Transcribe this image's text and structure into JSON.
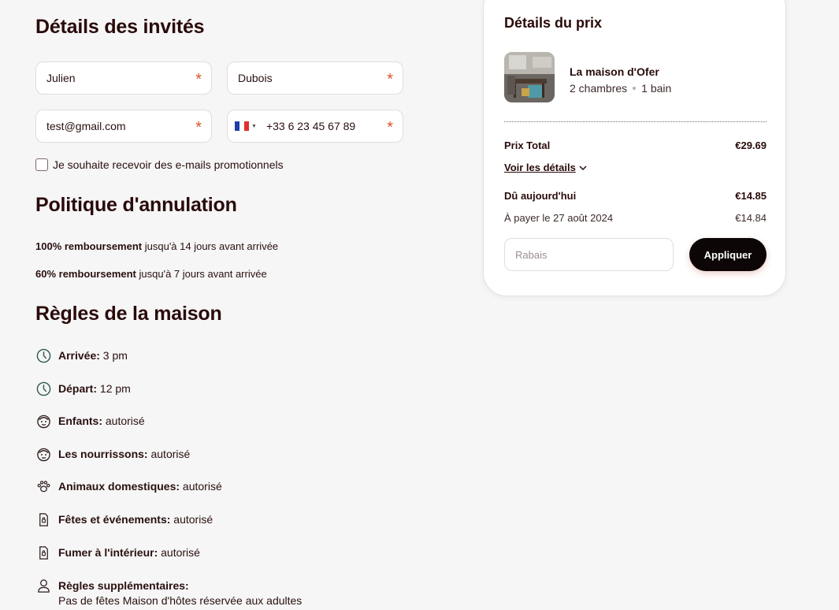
{
  "guest": {
    "title": "Détails des invités",
    "first_name": "Julien",
    "last_name": "Dubois",
    "email": "test@gmail.com",
    "phone": "+33 6 23 45 67 89",
    "required_mark": "*",
    "promo_label": "Je souhaite recevoir des e-mails promotionnels"
  },
  "cancellation": {
    "title": "Politique d'annulation",
    "items": [
      {
        "bold": "100% remboursement",
        "text": " jusqu'à 14 jours avant arrivée"
      },
      {
        "bold": "60% remboursement",
        "text": " jusqu'à 7 jours avant arrivée"
      }
    ]
  },
  "rules": {
    "title": "Règles de la maison",
    "items": [
      {
        "icon": "clock-icon",
        "label": "Arrivée:",
        "value": " 3 pm"
      },
      {
        "icon": "clock-icon",
        "label": "Départ:",
        "value": " 12 pm"
      },
      {
        "icon": "child-face-icon",
        "label": "Enfants:",
        "value": " autorisé"
      },
      {
        "icon": "child-face-icon",
        "label": "Les nourrissons:",
        "value": " autorisé"
      },
      {
        "icon": "paw-icon",
        "label": "Animaux domestiques:",
        "value": " autorisé"
      },
      {
        "icon": "event-doc-icon",
        "label": "Fêtes et événements:",
        "value": " autorisé"
      },
      {
        "icon": "event-doc-icon",
        "label": "Fumer à l'intérieur:",
        "value": " autorisé"
      },
      {
        "icon": "person-icon",
        "label": "Règles supplémentaires:",
        "value": "Pas de fêtes Maison d'hôtes réservée aux adultes"
      }
    ]
  },
  "price": {
    "title": "Détails du prix",
    "property_name": "La maison d'Ofer",
    "bedrooms": "2 chambres",
    "baths": "1 bain",
    "total_label": "Prix Total",
    "total_value": "€29.69",
    "details_link": "Voir les détails",
    "due_today_label": "Dû aujourd'hui",
    "due_today_value": "€14.85",
    "later_label": "À payer le 27 août 2024",
    "later_value": "€14.84",
    "discount_placeholder": "Rabais",
    "apply_label": "Appliquer"
  },
  "colors": {
    "accent_required": "#d9532f",
    "button_dark": "#0d0606",
    "heading": "#2a0a0a"
  }
}
